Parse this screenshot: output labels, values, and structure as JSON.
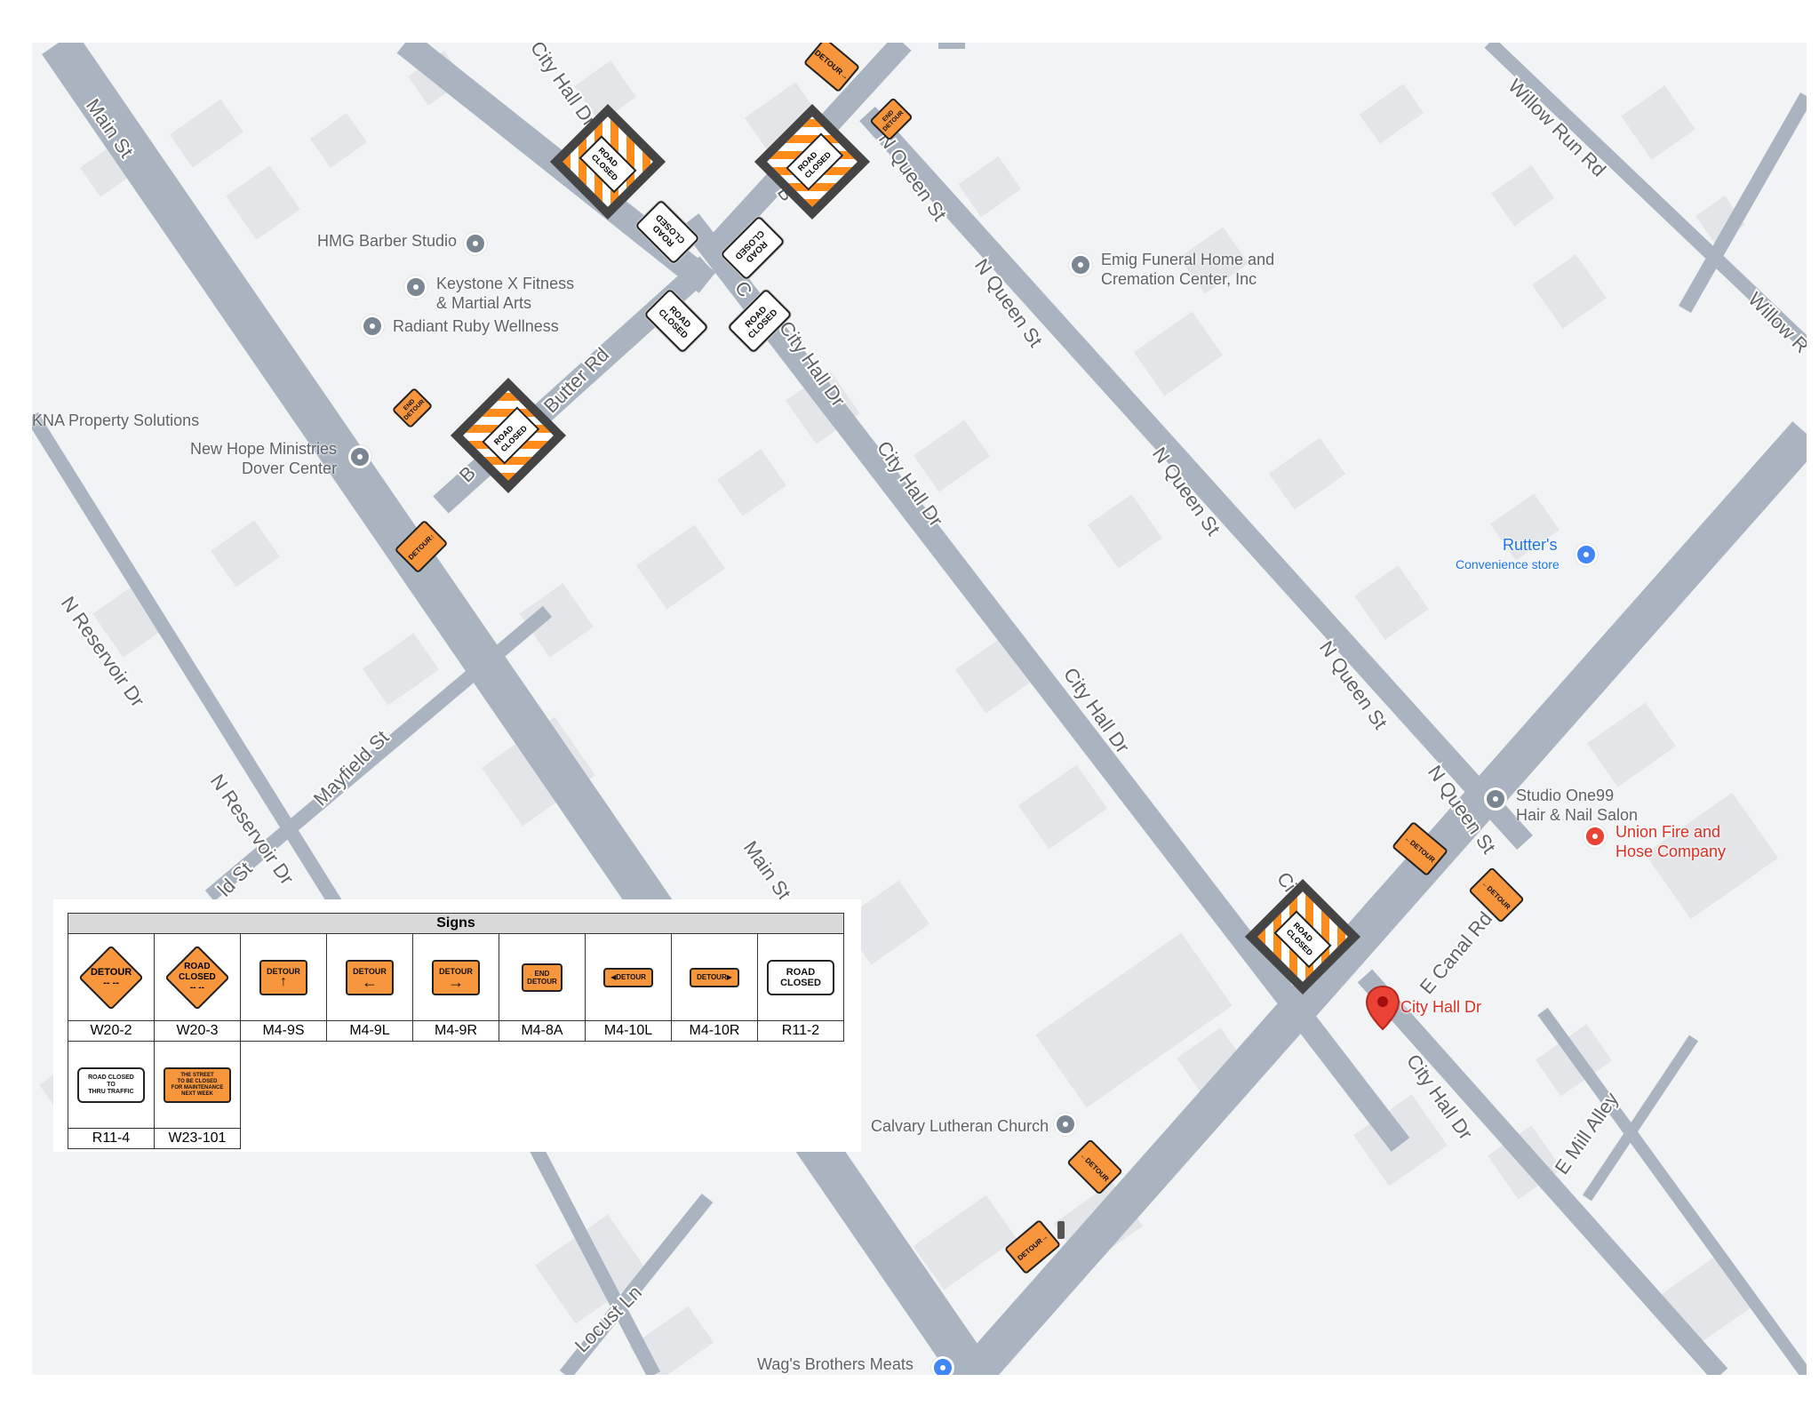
{
  "roads": [
    "Main St",
    "Main St",
    "City Hall Dr",
    "City Hall Dr",
    "City Hall Dr",
    "City Hall Dr",
    "City Hall Dr",
    "N Queen St",
    "N Queen St",
    "N Queen St",
    "N Queen St",
    "N Queen St",
    "Willow Run Rd",
    "Willow R",
    "Butter Rd",
    "B",
    "E Canal Rd",
    "N Reservoir Dr",
    "N Reservoir Dr",
    "Mayfield St",
    "Locust Ln",
    "E Mill Alley",
    "City",
    "B",
    "C",
    "ld St"
  ],
  "pois": [
    {
      "name": "HMG Barber Studio"
    },
    {
      "name": "Keystone X Fitness\n& Martial Arts"
    },
    {
      "name": "Radiant Ruby Wellness"
    },
    {
      "name": "KNA Property Solutions"
    },
    {
      "name": "New Hope Ministries\nDover Center"
    },
    {
      "name": "Emig Funeral Home and\nCremation Center, Inc"
    },
    {
      "name": "Rutter's",
      "sub": "Convenience store"
    },
    {
      "name": "Studio One99\nHair & Nail Salon"
    },
    {
      "name": "Union Fire and\nHose Company"
    },
    {
      "name": "City Hall Dr"
    },
    {
      "name": "Calvary Lutheran Church"
    },
    {
      "name": "Wag's Brothers Meats"
    }
  ],
  "map_signs": {
    "detour": "DETOUR",
    "end_detour": "END\nDETOUR",
    "road_closed": "ROAD\nCLOSED"
  },
  "legend": {
    "title": "Signs",
    "items": [
      {
        "code": "W20-2",
        "text": "DETOUR\n-- --"
      },
      {
        "code": "W20-3",
        "text": "ROAD\nCLOSED\n-- --"
      },
      {
        "code": "M4-9S",
        "text": "DETOUR",
        "arrow": "↑"
      },
      {
        "code": "M4-9L",
        "text": "DETOUR",
        "arrow": "←"
      },
      {
        "code": "M4-9R",
        "text": "DETOUR",
        "arrow": "→"
      },
      {
        "code": "M4-8A",
        "text": "END\nDETOUR"
      },
      {
        "code": "M4-10L",
        "text": "DETOUR",
        "arrow": "◀"
      },
      {
        "code": "M4-10R",
        "text": "DETOUR",
        "arrow": "▶"
      },
      {
        "code": "R11-2",
        "text": "ROAD\nCLOSED"
      },
      {
        "code": "R11-4",
        "text": "ROAD CLOSED\nTO\nTHRU TRAFFIC"
      },
      {
        "code": "W23-101",
        "text": "THE STREET\nTO BE CLOSED\nFOR MAINTENANCE\nNEXT WEEK"
      }
    ]
  },
  "colors": {
    "map_bg": "#f1f3f4",
    "road": "#aab4c1",
    "building": "#e3e5e8",
    "sign_orange": "#f7963d",
    "poi_gray": "#7a8793",
    "poi_red": "#ea4335",
    "poi_blue": "#4285f4"
  }
}
